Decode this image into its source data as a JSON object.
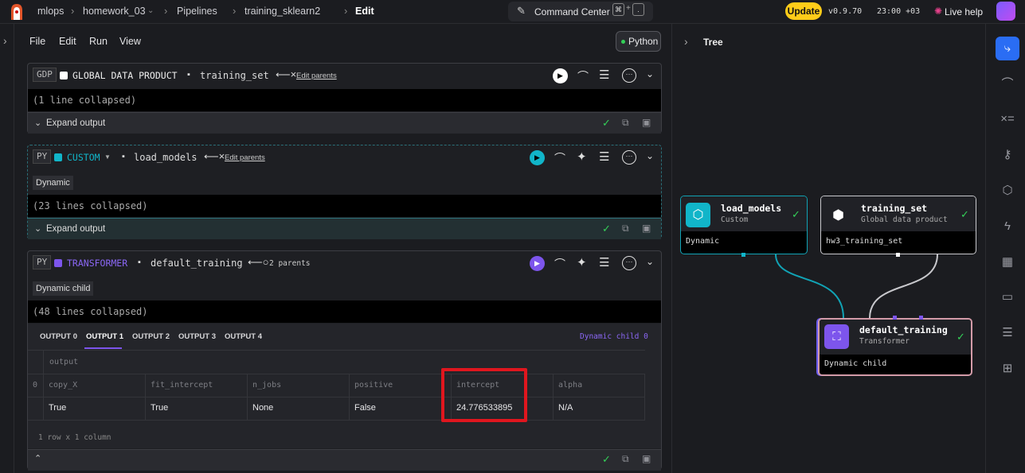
{
  "breadcrumb": {
    "project": "mlops",
    "folder": "homework_03",
    "section": "Pipelines",
    "pipeline": "training_sklearn2",
    "mode": "Edit"
  },
  "command_center": {
    "label": "Command Center",
    "key1": "⌘",
    "plus": "+",
    "key2": "."
  },
  "topright": {
    "update": "Update",
    "version": "v0.9.70",
    "time": "23:00 +03",
    "live_help": "Live help"
  },
  "menu": {
    "file": "File",
    "edit": "Edit",
    "run": "Run",
    "view": "View",
    "language": "Python"
  },
  "blocks": [
    {
      "lang": "GDP",
      "type": "GLOBAL DATA PRODUCT",
      "name": "training_set",
      "parents": "Edit parents",
      "collapsed": "(1 line collapsed)",
      "expand": "Expand output",
      "color": "#ffffff"
    },
    {
      "lang": "PY",
      "type": "CUSTOM",
      "name": "load_models",
      "parents": "Edit parents",
      "badge": "Dynamic",
      "collapsed": "(23 lines collapsed)",
      "expand": "Expand output",
      "color": "#11b5c9"
    },
    {
      "lang": "PY",
      "type": "TRANSFORMER",
      "name": "default_training",
      "parents": "2 parents",
      "badge": "Dynamic child",
      "collapsed": "(48 lines collapsed)",
      "color": "#7d55ec"
    }
  ],
  "outputs": {
    "tabs": [
      "OUTPUT 0",
      "OUTPUT 1",
      "OUTPUT 2",
      "OUTPUT 3",
      "OUTPUT 4"
    ],
    "active": "OUTPUT 1",
    "dynamic_label": "Dynamic child 0",
    "header_label": "output",
    "row_index": "0",
    "columns": [
      "copy_X",
      "fit_intercept",
      "n_jobs",
      "positive",
      "intercept",
      "alpha"
    ],
    "values": [
      "True",
      "True",
      "None",
      "False",
      "24.776533895",
      "N/A"
    ],
    "summary": "1 row x 1 column"
  },
  "tree": {
    "title": "Tree",
    "nodes": [
      {
        "name": "load_models",
        "type": "Custom",
        "footer": "Dynamic"
      },
      {
        "name": "training_set",
        "type": "Global data product",
        "footer": "hw3_training_set"
      },
      {
        "name": "default_training",
        "type": "Transformer",
        "footer": "Dynamic child"
      }
    ]
  },
  "colors": {
    "accent_yellow": "#ffcc19",
    "custom": "#11b5c9",
    "transformer": "#7d55ec",
    "success": "#34d058",
    "highlight": "#e0161e"
  },
  "icons": [
    "logo-icon",
    "chevron-down-icon",
    "command-icon",
    "sparkle-icon",
    "run-icon",
    "chart-icon",
    "ai-icon",
    "settings-icon",
    "more-icon",
    "check-icon",
    "open-icon",
    "save-icon",
    "tree-icon",
    "variables-icon",
    "key-icon",
    "cube-icon",
    "bolt-icon",
    "table-icon",
    "terminal-icon",
    "sliders-icon",
    "blocks-icon"
  ]
}
